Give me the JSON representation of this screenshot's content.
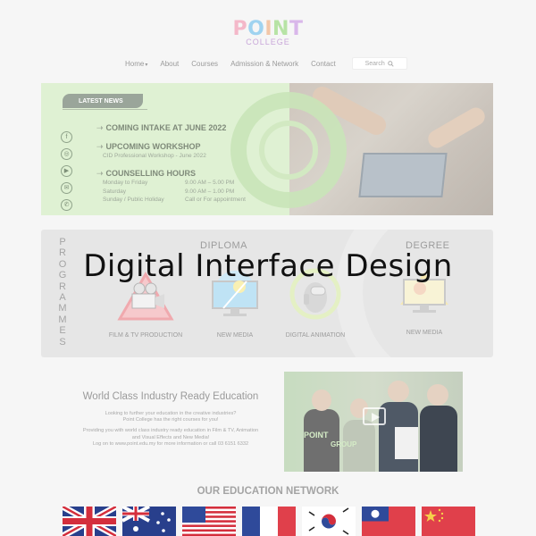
{
  "brand": {
    "logo_word": [
      "P",
      "O",
      "I",
      "N",
      "T"
    ],
    "logo_sub": "COLLEGE"
  },
  "nav": {
    "items": [
      "Home",
      "About",
      "Courses",
      "Admission & Network",
      "Contact"
    ],
    "home_caret": "▾",
    "search_placeholder": "Search",
    "search_icon": "magnifier"
  },
  "hero": {
    "badge": "LATEST NEWS",
    "intake": "COMING INTAKE AT JUNE 2022",
    "workshop_title": "UPCOMING WORKSHOP",
    "workshop_sub": "CID Professional Workshop - June 2022",
    "hours_title": "COUNSELLING HOURS",
    "hours": [
      {
        "day": "Monday to Friday",
        "time": "9.00 AM – 5.00 PM"
      },
      {
        "day": "Saturday",
        "time": "9.00 AM – 1.00 PM"
      },
      {
        "day": "Sunday / Public Holiday",
        "time": "Call or For appointment"
      }
    ],
    "social_icons": [
      "facebook-icon",
      "instagram-icon",
      "youtube-icon",
      "email-icon",
      "whatsapp-icon"
    ]
  },
  "programmes": {
    "vertical_label": "PROGRAMMES",
    "diploma": "DIPLOMA",
    "degree": "DEGREE",
    "courses": [
      "FILM & TV PRODUCTION",
      "NEW MEDIA",
      "DIGITAL ANIMATION",
      "NEW MEDIA"
    ]
  },
  "overlay_title": "Digital Interface Design",
  "about": {
    "title": "World Class Industry Ready Education",
    "p1a": "Looking to further your education in the creative industries?",
    "p1b": "Point College has the right courses for you!",
    "p2a": "Providing you with world class industry ready education in Film & TV, Animation",
    "p2b": "and Visual Effects and New Media!",
    "p2c": "Log on to www.point.edu.my for more information or call 03 6151 6332",
    "video_brand": "POINT",
    "video_brand2": "GROUP"
  },
  "network": {
    "title": "OUR EDUCATION NETWORK",
    "flags": [
      "uk",
      "australia",
      "usa",
      "france",
      "south-korea",
      "taiwan",
      "china"
    ]
  },
  "colors": {
    "hero_green": "#dff1d3",
    "accent_logo": "#9fd3f0"
  }
}
